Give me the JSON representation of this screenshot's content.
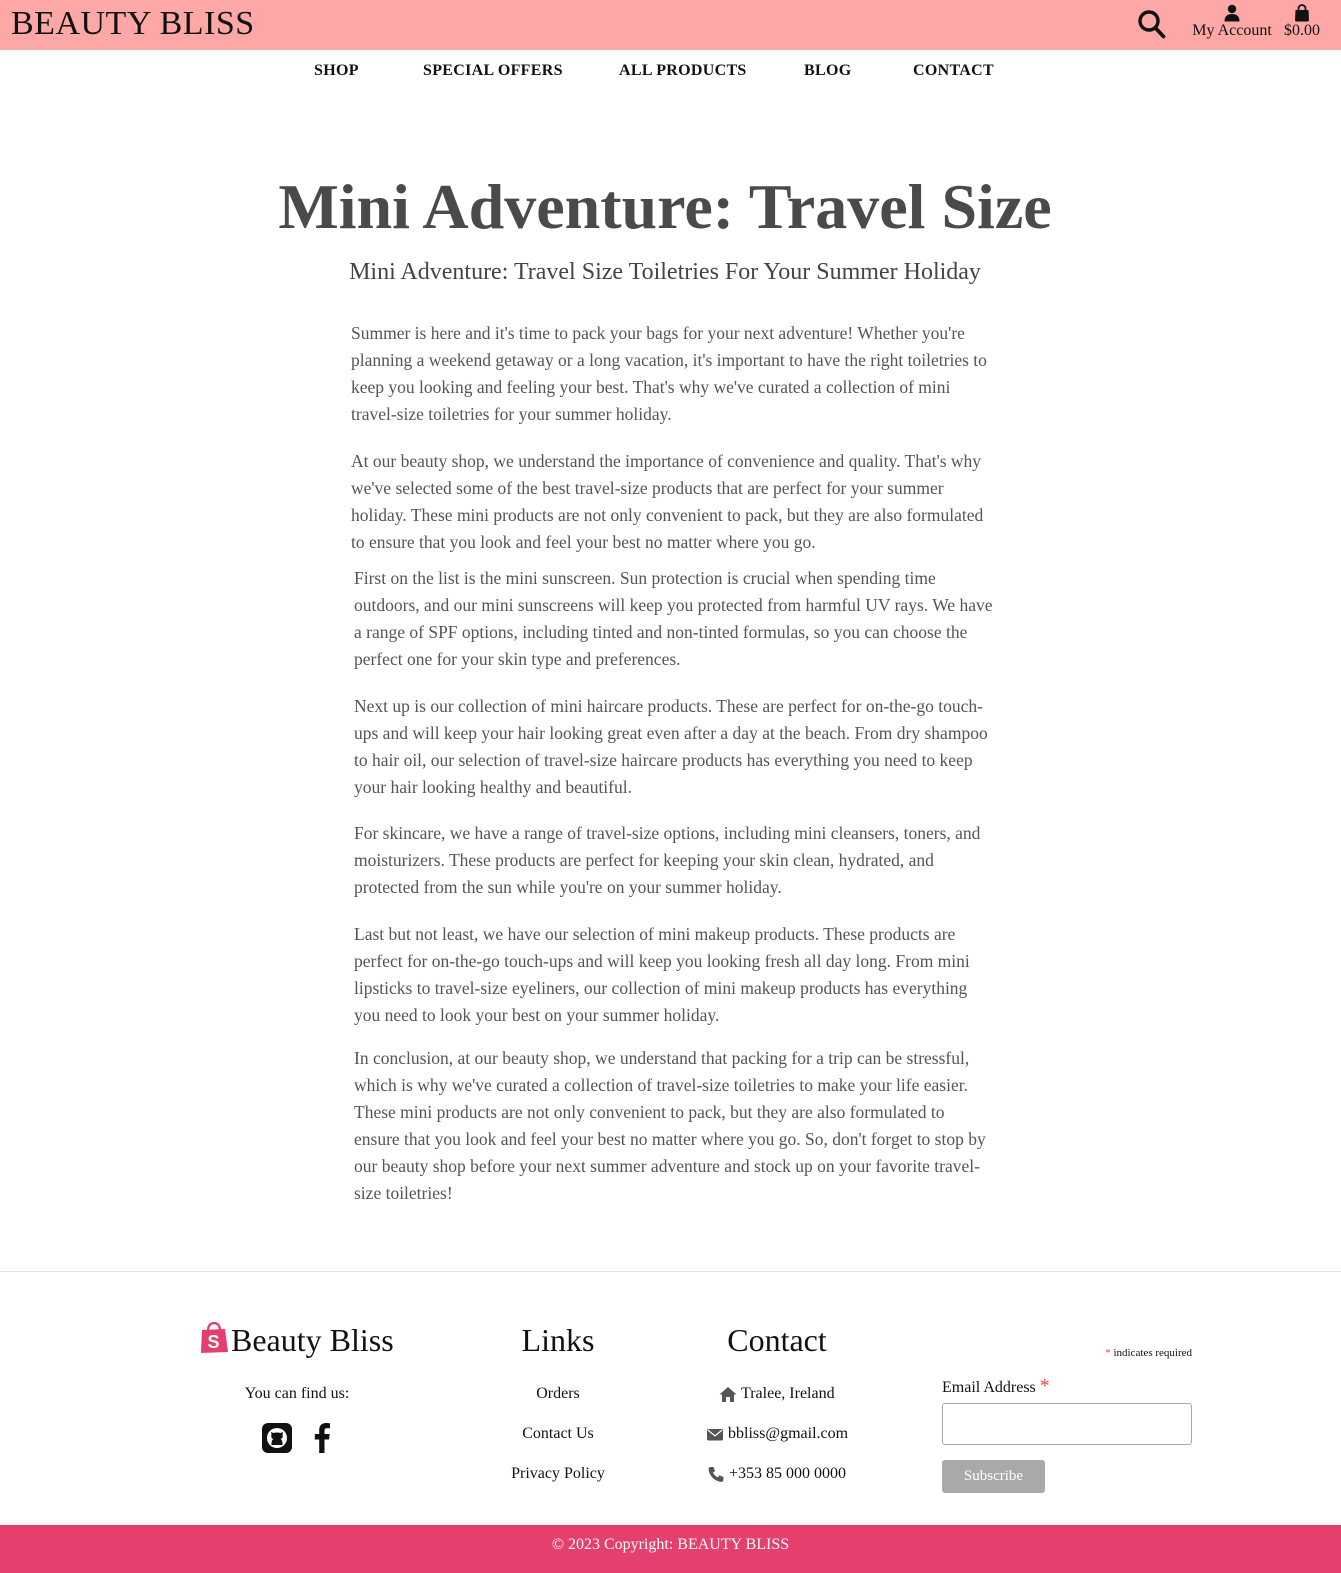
{
  "header": {
    "brand": "BEAUTY BLISS",
    "account_label": "My Account",
    "cart_total": "$0.00",
    "colors": {
      "bar": "#fda8a6"
    }
  },
  "nav": {
    "items": [
      {
        "label": "SHOP"
      },
      {
        "label": "SPECIAL OFFERS"
      },
      {
        "label": "ALL PRODUCTS"
      },
      {
        "label": "BLOG"
      },
      {
        "label": "CONTACT"
      }
    ]
  },
  "article": {
    "title": "Mini Adventure: Travel Size",
    "subtitle": "Mini Adventure: Travel Size Toiletries For Your Summer Holiday",
    "paragraphs": [
      "Summer is here and it's time to pack your bags for your next adventure! Whether you're planning a weekend getaway or a long vacation, it's important to have the right toiletries to keep you looking and feeling your best. That's why we've curated a collection of mini travel-size toiletries for your summer holiday.",
      "At our beauty shop, we understand the importance of convenience and quality. That's why we've selected some of the best travel-size products that are perfect for your summer holiday. These mini products are not only convenient to pack, but they are also formulated to ensure that you look and feel your best no matter where you go.",
      "First on the list is the mini sunscreen. Sun protection is crucial when spending time outdoors, and our mini sunscreens will keep you protected from harmful UV rays. We have a range of SPF options, including tinted and non-tinted formulas, so you can choose the perfect one for your skin type and preferences.",
      "Next up is our collection of mini haircare products. These are perfect for on-the-go touch-ups and will keep your hair looking great even after a day at the beach. From dry shampoo to hair oil, our selection of travel-size haircare products has everything you need to keep your hair looking healthy and beautiful.",
      "For skincare, we have a range of travel-size options, including mini cleansers, toners, and moisturizers. These products are perfect for keeping your skin clean, hydrated, and protected from the sun while you're on your summer holiday.",
      "Last but not least, we have our selection of mini makeup products. These products are perfect for on-the-go touch-ups and will keep you looking fresh all day long. From mini lipsticks to travel-size eyeliners, our collection of mini makeup products has everything you need to look your best on your summer holiday.",
      "In conclusion, at our beauty shop, we understand that packing for a trip can be stressful, which is why we've curated a collection of travel-size toiletries to make your life easier. These mini products are not only convenient to pack, but they are also formulated to ensure that you look and feel your best no matter where you go. So, don't forget to stop by our beauty shop before your next summer adventure and stock up on your favorite travel-size toiletries!"
    ]
  },
  "footer": {
    "brand": "Beauty Bliss",
    "find_us": "You can find us:",
    "links_heading": "Links",
    "links": [
      "Orders",
      "Contact Us",
      "Privacy Policy"
    ],
    "contact_heading": "Contact",
    "contact": {
      "address": "Tralee, Ireland",
      "email": "bbliss@gmail.com",
      "phone": "+353 85 000 0000"
    },
    "newsletter": {
      "required_note": "indicates required",
      "email_label": "Email Address",
      "asterisk": "*",
      "subscribe_label": "Subscribe",
      "email_value": ""
    },
    "copyright": "© 2023 Copyright: BEAUTY BLISS",
    "colors": {
      "brand_pink": "#e43f6d",
      "button_gray": "#a9a9a9"
    }
  }
}
